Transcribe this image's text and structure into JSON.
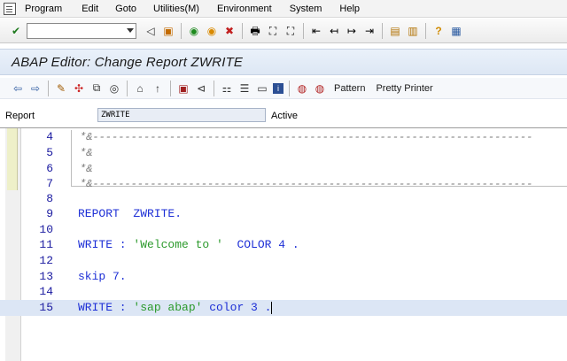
{
  "menubar": {
    "items": [
      "Program",
      "Edit",
      "Goto",
      "Utilities(M)",
      "Environment",
      "System",
      "Help"
    ]
  },
  "toolbar": {
    "command_value": "",
    "icons": [
      "enter-icon",
      "back-icon",
      "save-icon",
      "back-green-icon",
      "exit-icon",
      "cancel-icon",
      "print-icon",
      "find-icon",
      "find-next-icon",
      "first-page-icon",
      "prev-page-icon",
      "next-page-icon",
      "last-page-icon",
      "new-session-icon",
      "shortcut-icon",
      "help-icon",
      "layout-icon"
    ]
  },
  "title": "ABAP Editor: Change Report ZWRITE",
  "app_toolbar": {
    "pattern_label": "Pattern",
    "pretty_printer_label": "Pretty Printer"
  },
  "report": {
    "label": "Report",
    "value": "ZWRITE",
    "status": "Active"
  },
  "editor": {
    "lines": [
      {
        "num": "4",
        "text": "*&---------------------------------------------------------------------"
      },
      {
        "num": "5",
        "text": "*&"
      },
      {
        "num": "6",
        "text": "*&"
      },
      {
        "num": "7",
        "text": "*&---------------------------------------------------------------------"
      },
      {
        "num": "8",
        "text": ""
      },
      {
        "num": "9",
        "text": "REPORT  ZWRITE."
      },
      {
        "num": "10",
        "text": ""
      },
      {
        "num": "11",
        "text_kw": "WRITE : ",
        "text_str": "'Welcome to '",
        "text_rest": "  COLOR 4 ."
      },
      {
        "num": "12",
        "text": ""
      },
      {
        "num": "13",
        "text": "skip 7."
      },
      {
        "num": "14",
        "text": ""
      },
      {
        "num": "15",
        "text_kw": "WRITE : ",
        "text_str": "'sap abap'",
        "text_rest": " color 3 ."
      }
    ]
  },
  "colors": {
    "keyword": "#1d2fd6",
    "string": "#2c9a2c",
    "comment": "#7a7a7a",
    "current_line": "#dce6f5"
  }
}
